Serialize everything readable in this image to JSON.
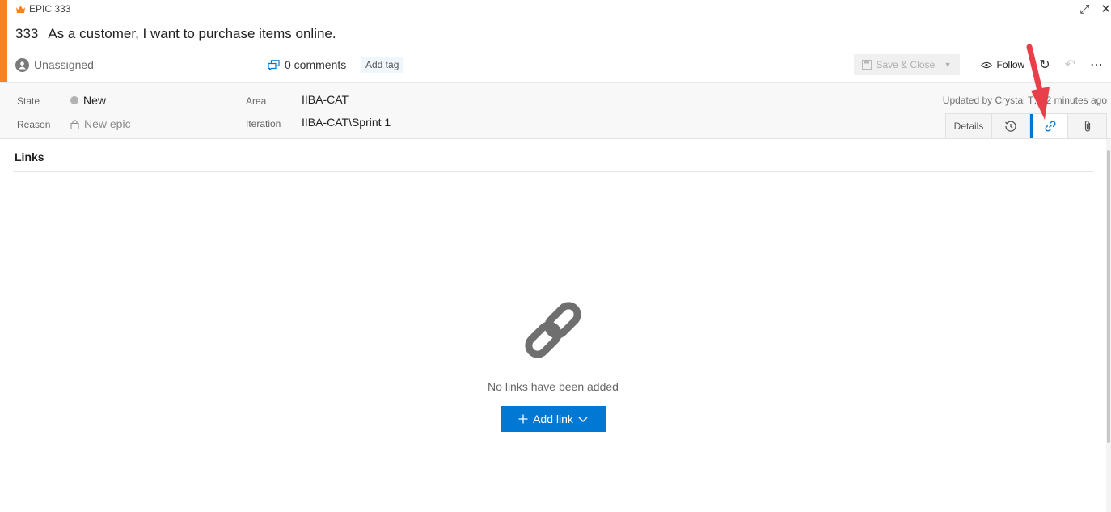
{
  "work_item": {
    "type_label": "EPIC 333",
    "id": "333",
    "title": "As a customer, I want to purchase items online."
  },
  "window": {
    "expand_glyph": "⤢",
    "close_glyph": "✕"
  },
  "meta": {
    "assignee": "Unassigned",
    "comments": "0 comments",
    "add_tag": "Add tag"
  },
  "toolbar": {
    "save_close": "Save & Close",
    "follow": "Follow",
    "refresh_glyph": "↻",
    "undo_glyph": "↶",
    "more_glyph": "⋯"
  },
  "fields": {
    "state_label": "State",
    "state_value": "New",
    "reason_label": "Reason",
    "reason_value": "New epic",
    "area_label": "Area",
    "area_value": "IIBA-CAT",
    "iteration_label": "Iteration",
    "iteration_value": "IIBA-CAT\\Sprint 1",
    "updated": "Updated by Crystal T… 2 minutes ago"
  },
  "tabs": {
    "details": "Details"
  },
  "links_panel": {
    "title": "Links",
    "empty_text": "No links have been added",
    "add_link": "Add link"
  },
  "colors": {
    "accent": "#f7821e",
    "primary": "#0078d4",
    "annotation_arrow": "#e8404a"
  }
}
